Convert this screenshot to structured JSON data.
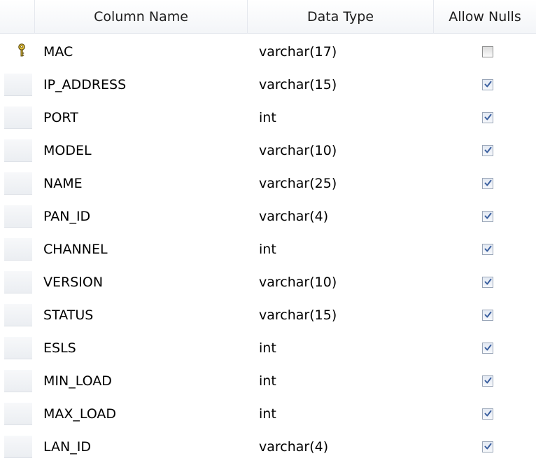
{
  "headers": {
    "column_name": "Column Name",
    "data_type": "Data Type",
    "allow_nulls": "Allow Nulls"
  },
  "rows": [
    {
      "name": "MAC",
      "type": "varchar(17)",
      "allow_nulls": false,
      "primary_key": true
    },
    {
      "name": "IP_ADDRESS",
      "type": "varchar(15)",
      "allow_nulls": true,
      "primary_key": false
    },
    {
      "name": "PORT",
      "type": "int",
      "allow_nulls": true,
      "primary_key": false
    },
    {
      "name": "MODEL",
      "type": "varchar(10)",
      "allow_nulls": true,
      "primary_key": false
    },
    {
      "name": "NAME",
      "type": "varchar(25)",
      "allow_nulls": true,
      "primary_key": false
    },
    {
      "name": "PAN_ID",
      "type": "varchar(4)",
      "allow_nulls": true,
      "primary_key": false
    },
    {
      "name": "CHANNEL",
      "type": "int",
      "allow_nulls": true,
      "primary_key": false
    },
    {
      "name": "VERSION",
      "type": "varchar(10)",
      "allow_nulls": true,
      "primary_key": false
    },
    {
      "name": "STATUS",
      "type": "varchar(15)",
      "allow_nulls": true,
      "primary_key": false
    },
    {
      "name": "ESLS",
      "type": "int",
      "allow_nulls": true,
      "primary_key": false
    },
    {
      "name": "MIN_LOAD",
      "type": "int",
      "allow_nulls": true,
      "primary_key": false
    },
    {
      "name": "MAX_LOAD",
      "type": "int",
      "allow_nulls": true,
      "primary_key": false
    },
    {
      "name": "LAN_ID",
      "type": "varchar(4)",
      "allow_nulls": true,
      "primary_key": false
    }
  ],
  "icons": {
    "primary_key": "key-icon",
    "checked": "checkbox-checked-icon",
    "unchecked": "checkbox-unchecked-icon"
  },
  "colors": {
    "key_fill": "#e8c43a",
    "check_mark": "#3a5f9f"
  }
}
